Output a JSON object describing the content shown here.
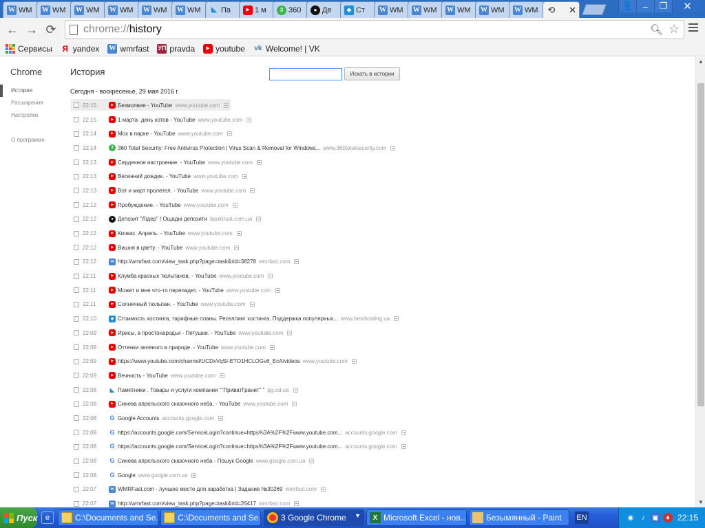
{
  "window": {
    "tabs": [
      {
        "label": "WM",
        "favicon": "wmrfast-icon"
      },
      {
        "label": "WM",
        "favicon": "wmrfast-icon"
      },
      {
        "label": "WM",
        "favicon": "wmrfast-icon"
      },
      {
        "label": "WM",
        "favicon": "wmrfast-icon"
      },
      {
        "label": "WM",
        "favicon": "wmrfast-icon"
      },
      {
        "label": "WM",
        "favicon": "wmrfast-icon"
      },
      {
        "label": "Па",
        "favicon": "pg-icon"
      },
      {
        "label": "1 м",
        "favicon": "youtube-icon"
      },
      {
        "label": "360",
        "favicon": "360-icon"
      },
      {
        "label": "Де",
        "favicon": "banktrust-icon"
      },
      {
        "label": "Ст",
        "favicon": "besthosting-icon"
      },
      {
        "label": "WM",
        "favicon": "wmrfast-icon"
      },
      {
        "label": "WM",
        "favicon": "wmrfast-icon"
      },
      {
        "label": "WM",
        "favicon": "wmrfast-icon"
      },
      {
        "label": "WM",
        "favicon": "wmrfast-icon"
      },
      {
        "label": "WM",
        "favicon": "wmrfast-icon"
      }
    ],
    "active_tab_close": "✕",
    "controls": {
      "user": "👤",
      "minimize": "–",
      "maximize": "❐",
      "close": "✕"
    }
  },
  "toolbar": {
    "back": "←",
    "forward": "→",
    "reload": "⟳",
    "url_scheme": "chrome://",
    "url_path": "history"
  },
  "bookmarks": [
    {
      "label": "Сервисы",
      "icon": "apps-icon"
    },
    {
      "label": "yandex",
      "icon": "yandex-icon"
    },
    {
      "label": "wmrfast",
      "icon": "wmrfast-icon"
    },
    {
      "label": "pravda",
      "icon": "pravda-icon"
    },
    {
      "label": "youtube",
      "icon": "youtube-icon"
    },
    {
      "label": "Welcome! | VK",
      "icon": "vk-icon"
    }
  ],
  "sidebar": {
    "brand": "Chrome",
    "items": [
      {
        "label": "История",
        "selected": true
      },
      {
        "label": "Расширения",
        "selected": false
      },
      {
        "label": "Настройки",
        "selected": false
      }
    ],
    "about": "О программе"
  },
  "history": {
    "title": "История",
    "search_placeholder": "",
    "search_button": "Искать в истории",
    "day_header": "Сегодня - воскресенье, 29 мая 2016 г.",
    "entries": [
      {
        "time": "22:15",
        "icon": "yt",
        "title": "Безмолвие - YouTube",
        "domain": "www.youtube.com"
      },
      {
        "time": "22:15",
        "icon": "yt",
        "title": "1 марта- день котов - YouTube",
        "domain": "www.youtube.com"
      },
      {
        "time": "22:14",
        "icon": "yt",
        "title": "Мох в парке - YouTube",
        "domain": "www.youtube.com"
      },
      {
        "time": "22:14",
        "icon": "360",
        "title": "360 Total Security: Free Antivirus Protection | Virus Scan & Removal for Windows...",
        "domain": "www.360totalsecurity.com"
      },
      {
        "time": "22:13",
        "icon": "yt",
        "title": "Сердечное настроение. - YouTube",
        "domain": "www.youtube.com"
      },
      {
        "time": "22:13",
        "icon": "yt",
        "title": "Весенний дождик. - YouTube",
        "domain": "www.youtube.com"
      },
      {
        "time": "22:13",
        "icon": "yt",
        "title": "Вот и март пролетел. - YouTube",
        "domain": "www.youtube.com"
      },
      {
        "time": "22:12",
        "icon": "yt",
        "title": "Пробуждение. - YouTube",
        "domain": "www.youtube.com"
      },
      {
        "time": "22:12",
        "icon": "bank",
        "title": "Депозит \"Лідер\" / Ощадні депозити",
        "domain": "banktrust.com.ua"
      },
      {
        "time": "22:12",
        "icon": "yt",
        "title": "Кичкас. Апрель. - YouTube",
        "domain": "www.youtube.com"
      },
      {
        "time": "22:12",
        "icon": "yt",
        "title": "Вишня в цвету. - YouTube",
        "domain": "www.youtube.com"
      },
      {
        "time": "22:12",
        "icon": "w",
        "title": "http://wmrfast.com/view_task.php?page=task&rid=38278",
        "domain": "wmrfast.com"
      },
      {
        "time": "22:11",
        "icon": "yt",
        "title": "Клумба красных тюльпанов. - YouTube",
        "domain": "www.youtube.com"
      },
      {
        "time": "22:11",
        "icon": "yt",
        "title": "Может и мне что-то перепадет. - YouTube",
        "domain": "www.youtube.com"
      },
      {
        "time": "22:11",
        "icon": "yt",
        "title": "Солнечный тюльпан. - YouTube",
        "domain": "www.youtube.com"
      },
      {
        "time": "22:10",
        "icon": "host",
        "title": "Стоимость хостинга, тарифные планы. Реселлинг хостинга. Поддержка популярных...",
        "domain": "www.besthosting.ua"
      },
      {
        "time": "22:09",
        "icon": "yt",
        "title": "Ирисы, в простонародьи - Петушки. - YouTube",
        "domain": "www.youtube.com"
      },
      {
        "time": "22:09",
        "icon": "yt",
        "title": "Оттенки зеленого в природе. - YouTube",
        "domain": "www.youtube.com"
      },
      {
        "time": "22:09",
        "icon": "yt",
        "title": "https://www.youtube.com/channel/UCDxVqSI-ETO1HCLOGv6_EcA/videos",
        "domain": "www.youtube.com"
      },
      {
        "time": "22:09",
        "icon": "yt",
        "title": "Вечность - YouTube",
        "domain": "www.youtube.com"
      },
      {
        "time": "22:08",
        "icon": "pg",
        "title": "Памятники . Товары и услуги компании \"\"ПриватГранит\" \"",
        "domain": "pg.od.ua"
      },
      {
        "time": "22:08",
        "icon": "yt",
        "title": "Синева апрельского сказочного неба. - YouTube",
        "domain": "www.youtube.com"
      },
      {
        "time": "22:08",
        "icon": "g",
        "title": "Google Accounts",
        "domain": "accounts.google.com"
      },
      {
        "time": "22:08",
        "icon": "g",
        "title": "https://accounts.google.com/ServiceLogin?continue=https%3A%2F%2Fwww.youtube.com...",
        "domain": "accounts.google.com"
      },
      {
        "time": "22:08",
        "icon": "g",
        "title": "https://accounts.google.com/ServiceLogin?continue=https%3A%2F%2Fwww.youtube.com...",
        "domain": "accounts.google.com"
      },
      {
        "time": "22:08",
        "icon": "g",
        "title": "Синева апрельского сказочного неба - Пошук Google",
        "domain": "www.google.com.ua"
      },
      {
        "time": "22:08",
        "icon": "g",
        "title": "Google",
        "domain": "www.google.com.ua"
      },
      {
        "time": "22:07",
        "icon": "w",
        "title": "WMRFast.com - лучшее место для заработка | Задание №30269",
        "domain": "wmrfast.com"
      },
      {
        "time": "22:07",
        "icon": "w",
        "title": "http://wmrfast.com/view_task.php?page=task&rid=26417",
        "domain": "wmrfast.com"
      }
    ]
  },
  "taskbar": {
    "start": "Пуск",
    "tasks": [
      {
        "label": "C:\\Documents and Se...",
        "icon": "folder"
      },
      {
        "label": "C:\\Documents and Se...",
        "icon": "folder"
      },
      {
        "label": "3 Google Chrome",
        "icon": "chrome"
      },
      {
        "label": "Microsoft Excel - нов...",
        "icon": "excel"
      },
      {
        "label": "Безымянный - Paint",
        "icon": "paint"
      }
    ],
    "lang": "EN",
    "clock": "22:15"
  }
}
